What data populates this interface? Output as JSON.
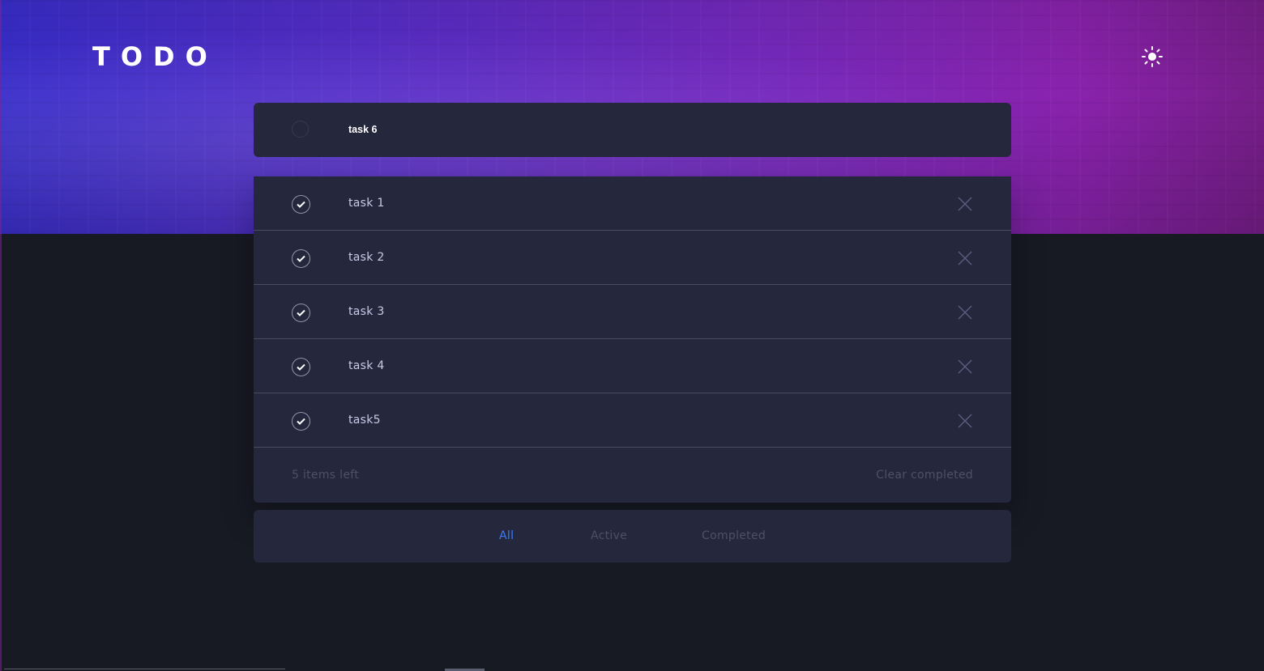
{
  "header": {
    "title": "TODO",
    "theme_icon": "sun-icon"
  },
  "new_task": {
    "value": "task 6"
  },
  "tasks": [
    {
      "label": "task 1",
      "completed": true
    },
    {
      "label": "task 2",
      "completed": true
    },
    {
      "label": "task 3",
      "completed": true
    },
    {
      "label": "task 4",
      "completed": true
    },
    {
      "label": "task5",
      "completed": true
    }
  ],
  "footer": {
    "items_left": "5 items left",
    "clear_completed": "Clear completed"
  },
  "filters": {
    "all": "All",
    "active": "Active",
    "completed": "Completed",
    "selected": "All"
  },
  "colors": {
    "accent": "#3a7cfd",
    "card": "#25273d",
    "background": "#171923",
    "text": "#c8cbe7",
    "muted": "#4d5067"
  },
  "icons": {
    "check": "check-icon",
    "delete": "close-icon",
    "theme": "sun-icon"
  }
}
